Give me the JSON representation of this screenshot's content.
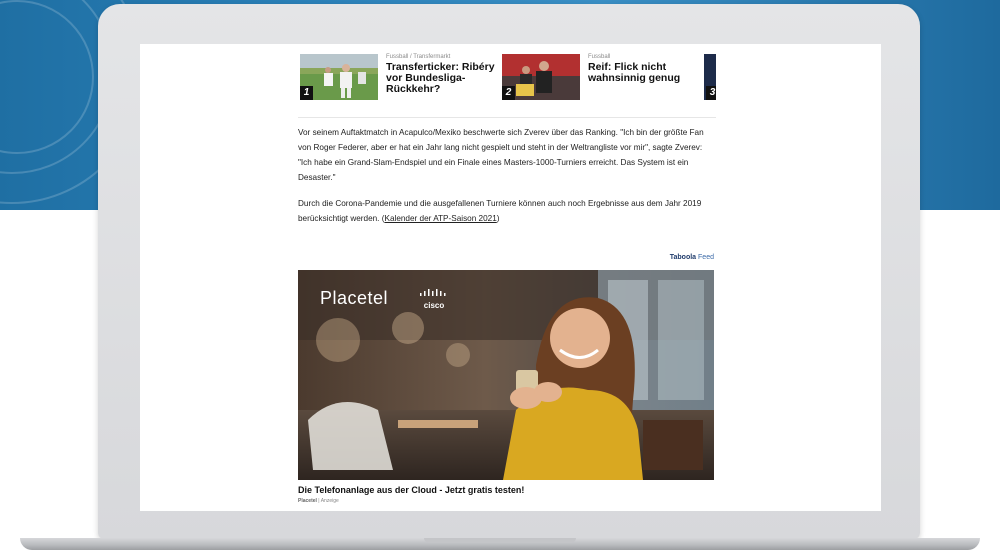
{
  "related": [
    {
      "number": "1",
      "kicker": "Fussball / Transfermarkt",
      "title": "Transferticker: Ribéry vor Bundesliga-Rückkehr?"
    },
    {
      "number": "2",
      "kicker": "Fussball",
      "title": "Reif: Flick nicht wahnsinnig genug"
    },
    {
      "number": "3"
    }
  ],
  "article": {
    "paragraph1": "Vor seinem Auftaktmatch in Acapulco/Mexiko beschwerte sich Zverev über das Ranking. \"Ich bin der größte Fan von Roger Federer, aber er hat ein Jahr lang nicht gespielt und steht in der Weltrangliste vor mir\", sagte Zverev: \"Ich habe ein Grand-Slam-Endspiel und ein Finale eines Masters-1000-Turniers erreicht. Das System ist ein Desaster.\"",
    "paragraph2_text": "Durch die Corona-Pandemie und die ausgefallenen Turniere können auch noch Ergebnisse aus dem Jahr 2019 berücksichtigt werden.",
    "paragraph2_link": "Kalender der ATP-Saison 2021"
  },
  "taboola": {
    "brand": "Taboola",
    "label": "Feed"
  },
  "ad": {
    "logo_text": "Placetel",
    "cisco_text": "cisco",
    "title": "Die Telefonanlage aus der Cloud - Jetzt gratis testen!",
    "source": "Placetel",
    "source_tag": "Anzeige"
  },
  "colors": {
    "page_bg_top": "#2a80b8",
    "laptop": "#dcdde0",
    "link_taboola": "#3b6aa8"
  }
}
